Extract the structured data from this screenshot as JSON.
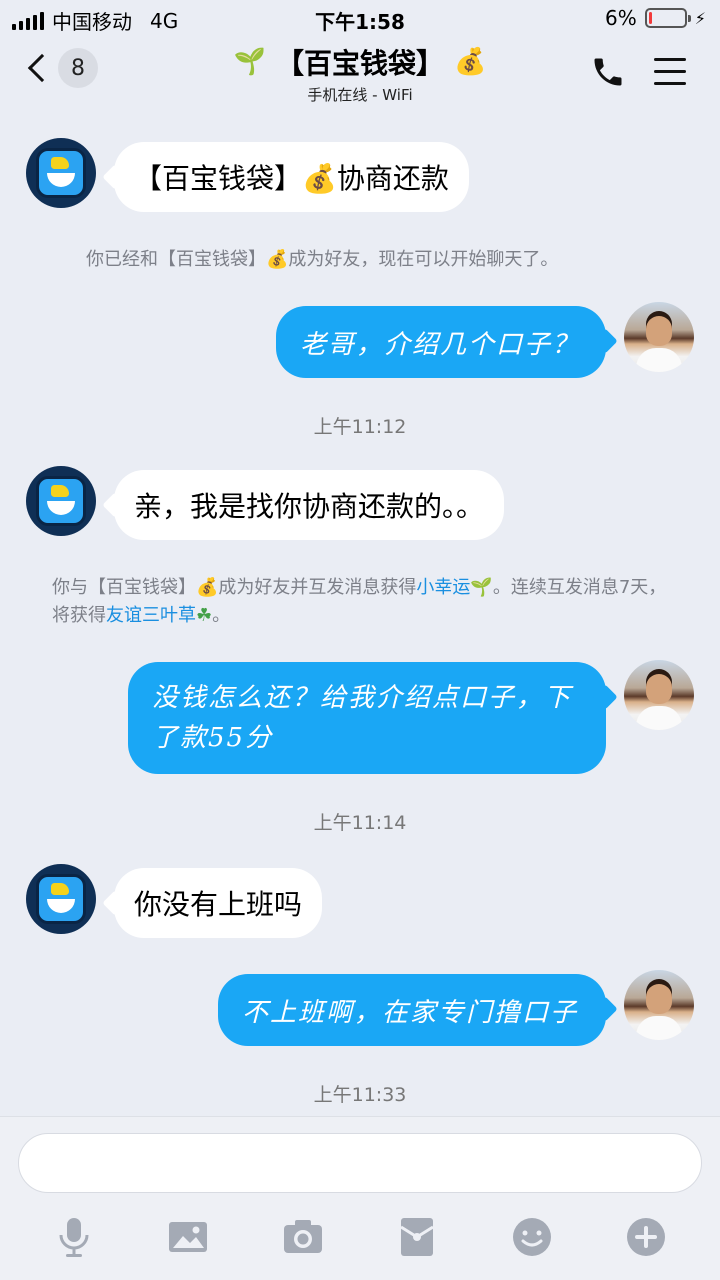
{
  "status_bar": {
    "carrier": "中国移动",
    "network": "4G",
    "time": "下午1:58",
    "battery_percent_text": "6%",
    "battery_level": 0.06
  },
  "header": {
    "unread_count": "8",
    "title": "【百宝钱袋】",
    "subtitle": "手机在线 - WiFi",
    "title_prefix_icon": "sprout-icon",
    "title_suffix_icon": "money-bag-icon"
  },
  "messages": {
    "m1": "【百宝钱袋】💰协商还款",
    "n1": "你已经和【百宝钱袋】💰成为好友，现在可以开始聊天了。",
    "m2": "老哥，介绍几个口子？",
    "t1": "上午11:12",
    "m3": "亲，我是找你协商还款的。。",
    "n2_a": "你与【百宝钱袋】💰成为好友并互发消息获得",
    "n2_link1": "小幸运",
    "n2_leaf1": "🌱",
    "n2_b": "。连续互发消息7天，将获得",
    "n2_link2": "友谊三叶草",
    "n2_leaf2": "☘",
    "n2_c": "。",
    "m4_line1": "没钱怎么还？给我介绍点口子，下",
    "m4_line2": "了款55分",
    "t2": "上午11:14",
    "m5": "你没有上班吗",
    "m6": "不上班啊，在家专门撸口子",
    "t3": "上午11:33"
  },
  "input": {
    "placeholder": ""
  },
  "toolbar_icons": [
    "microphone-icon",
    "image-icon",
    "camera-icon",
    "red-packet-icon",
    "emoji-icon",
    "plus-icon"
  ],
  "colors": {
    "accent": "#1aa7f5",
    "background": "#eaedf4",
    "battery_low": "#f23a3a"
  }
}
